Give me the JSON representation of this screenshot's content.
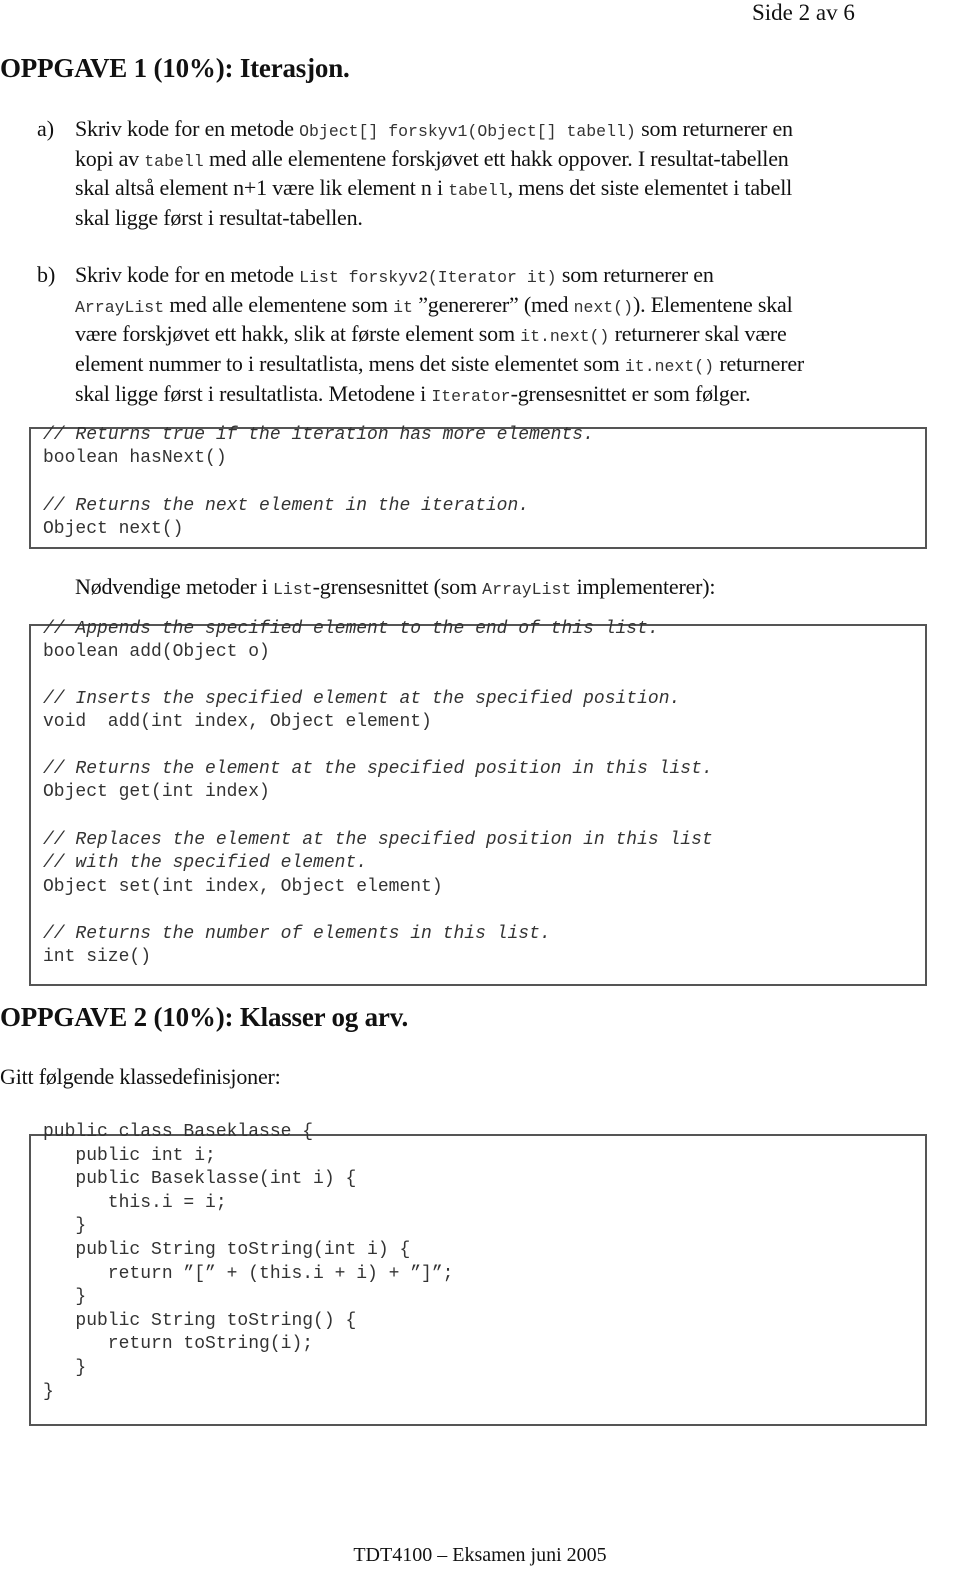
{
  "page": {
    "page_number": "Side 2 av 6",
    "footer": "TDT4100 – Eksamen juni 2005"
  },
  "task1": {
    "heading": "OPPGAVE 1 (10%):  Iterasjon.",
    "a": {
      "label": "a)",
      "lines": [
        [
          {
            "t": "Skriv kode for en metode "
          },
          {
            "c": "Object[] forskyv1(Object[] tabell)"
          },
          {
            "t": " som returnerer en"
          }
        ],
        [
          {
            "t": "kopi av "
          },
          {
            "c": "tabell"
          },
          {
            "t": " med alle elementene forskjøvet ett hakk oppover. I resultat-tabellen"
          }
        ],
        [
          {
            "t": "skal altså element n+1 være lik element n i "
          },
          {
            "c": "tabell"
          },
          {
            "t": ", mens det siste elementet i tabell"
          }
        ],
        [
          {
            "t": "skal ligge først i resultat-tabellen."
          }
        ]
      ]
    },
    "b": {
      "label": "b)",
      "lines": [
        [
          {
            "t": "Skriv kode for en metode "
          },
          {
            "c": "List forskyv2(Iterator it)"
          },
          {
            "t": " som returnerer en"
          }
        ],
        [
          {
            "c": "ArrayList"
          },
          {
            "t": " med alle elementene som "
          },
          {
            "c": "it"
          },
          {
            "t": " ”genererer” (med "
          },
          {
            "c": "next()"
          },
          {
            "t": "). Elementene skal"
          }
        ],
        [
          {
            "t": "være forskjøvet ett hakk, slik at første element som "
          },
          {
            "c": "it.next()"
          },
          {
            "t": " returnerer skal være"
          }
        ],
        [
          {
            "t": "element nummer to i resultatlista, mens det siste elementet som "
          },
          {
            "c": "it.next()"
          },
          {
            "t": " returnerer"
          }
        ],
        [
          {
            "t": "skal ligge først i resultatlista. Metodene i "
          },
          {
            "c": "Iterator"
          },
          {
            "t": "-grensesnittet er som følger."
          }
        ]
      ]
    },
    "iterator_box": {
      "lines": [
        {
          "text": "// Returns true if the iteration has more elements.",
          "comment": true
        },
        {
          "text": "boolean hasNext()",
          "comment": false
        },
        {
          "text": "// Returns the next element in the iteration.",
          "comment": true
        },
        {
          "text": "Object next()",
          "comment": false
        }
      ]
    },
    "list_intro": [
      {
        "t": "Nødvendige metoder i "
      },
      {
        "c": "List"
      },
      {
        "t": "-grensesnittet (som "
      },
      {
        "c": "ArrayList"
      },
      {
        "t": " implementerer):"
      }
    ],
    "list_box": {
      "lines": [
        {
          "text": "// Appends the specified element to the end of this list.",
          "comment": true
        },
        {
          "text": "boolean add(Object o)",
          "comment": false
        },
        {
          "text": "// Inserts the specified element at the specified position.",
          "comment": true
        },
        {
          "text": "void  add(int index, Object element)",
          "comment": false
        },
        {
          "text": "// Returns the element at the specified position in this list.",
          "comment": true
        },
        {
          "text": "Object get(int index)",
          "comment": false
        },
        {
          "text": "// Replaces the element at the specified position in this list",
          "comment": true
        },
        {
          "text": "// with the specified element.",
          "comment": true
        },
        {
          "text": "Object set(int index, Object element)",
          "comment": false
        },
        {
          "text": "// Returns the number of elements in this list.",
          "comment": true
        },
        {
          "text": "int size()",
          "comment": false
        }
      ]
    }
  },
  "task2": {
    "heading": "OPPGAVE 2 (10%):  Klasser og arv.",
    "intro": "Gitt følgende klassedefinisjoner:",
    "class_box": {
      "lines": [
        "public class Baseklasse {",
        "   public int i;",
        "   public Baseklasse(int i) {",
        "      this.i = i;",
        "   }",
        "   public String toString(int i) {",
        "      return ”[” + (this.i + i) + ”]”;",
        "   }",
        "   public String toString() {",
        "      return toString(i);",
        "   }",
        "}"
      ]
    }
  }
}
